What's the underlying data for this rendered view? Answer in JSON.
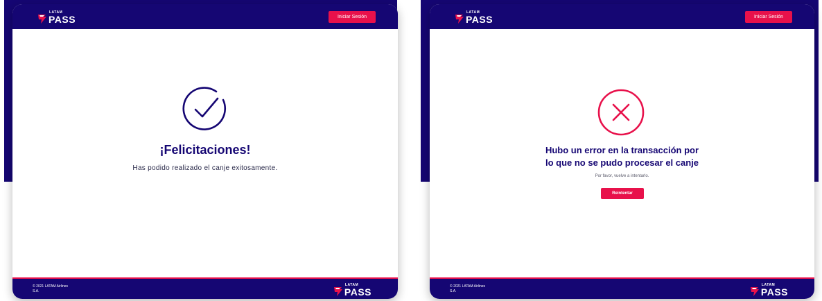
{
  "brand": {
    "logo_small": "LATAM",
    "logo_big": "PASS",
    "navy": "#150673",
    "accent": "#e8114b"
  },
  "header": {
    "login_label": "Iniciar Sesión"
  },
  "success_screen": {
    "icon": "check-circle-icon",
    "title": "¡Felicitaciones!",
    "message": "Has podido realizado el canje exitosamente."
  },
  "error_screen": {
    "icon": "x-circle-icon",
    "title_line1": "Hubo un error en la transacción por",
    "title_line2": "lo que no se pudo procesar el canje",
    "message": "Por favor, vuelve a intentarlo.",
    "retry_label": "Reintentar"
  },
  "footer": {
    "copyright_line1": "© 2021 LATAM Airlines",
    "copyright_line2": "S.A."
  }
}
